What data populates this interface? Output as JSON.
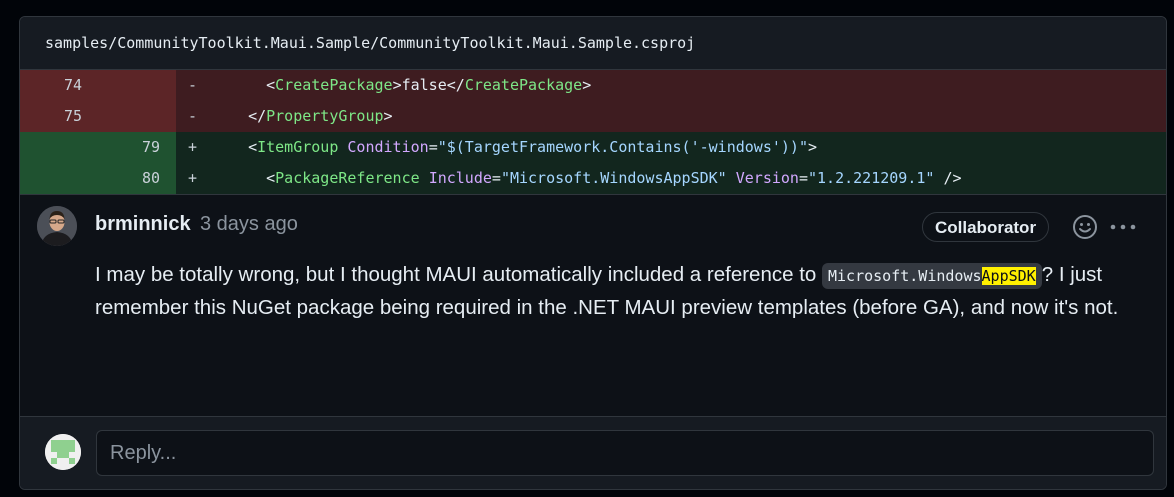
{
  "file": {
    "path": "samples/CommunityToolkit.Maui.Sample/CommunityToolkit.Maui.Sample.csproj"
  },
  "diff": {
    "rows": [
      {
        "type": "del",
        "old_line": "74",
        "new_line": "",
        "marker": "-"
      },
      {
        "type": "del",
        "old_line": "75",
        "new_line": "",
        "marker": "-"
      },
      {
        "type": "add",
        "old_line": "",
        "new_line": "79",
        "marker": "+"
      },
      {
        "type": "add",
        "old_line": "",
        "new_line": "80",
        "marker": "+"
      }
    ],
    "code": {
      "r0": {
        "indent": "    ",
        "open": "<",
        "tag": "CreatePackage",
        "close": ">",
        "text": "false",
        "end_open": "</",
        "end_tag": "CreatePackage",
        "end_close": ">"
      },
      "r1": {
        "indent": "  ",
        "open": "</",
        "tag": "PropertyGroup",
        "close": ">"
      },
      "r2": {
        "indent": "  ",
        "open": "<",
        "tag": "ItemGroup",
        "attr": "Condition",
        "eq": "=",
        "val": "\"$(TargetFramework.Contains('-windows'))\"",
        "close": ">"
      },
      "r3": {
        "indent": "    ",
        "open": "<",
        "tag": "PackageReference",
        "attr1": "Include",
        "eq1": "=",
        "val1": "\"Microsoft.WindowsAppSDK\"",
        "attr2": "Version",
        "eq2": "=",
        "val2": "\"1.2.221209.1\"",
        "close": " />"
      }
    }
  },
  "comment": {
    "author": "brminnick",
    "timestamp": "3 days ago",
    "badge": "Collaborator",
    "icons": {
      "reaction": "smiley-icon",
      "more": "kebab-horizontal-icon"
    },
    "body": {
      "part1": "I may be totally wrong, but I thought MAUI automatically included a reference to ",
      "code_prefix": "Microsoft.Windows",
      "code_highlight": "AppSDK",
      "part2": "? I just remember this NuGet package being required in the .NET MAUI preview templates (before GA), and now it's not."
    }
  },
  "reply": {
    "placeholder": "Reply..."
  },
  "colors": {
    "del_row": "#3e1c20",
    "del_gutter": "#5c2527",
    "add_row": "#12261e",
    "add_gutter": "#1f5230",
    "tag": "#7ee787",
    "attr": "#d2a8ff",
    "string": "#a5d6ff",
    "highlight": "#fff000"
  }
}
